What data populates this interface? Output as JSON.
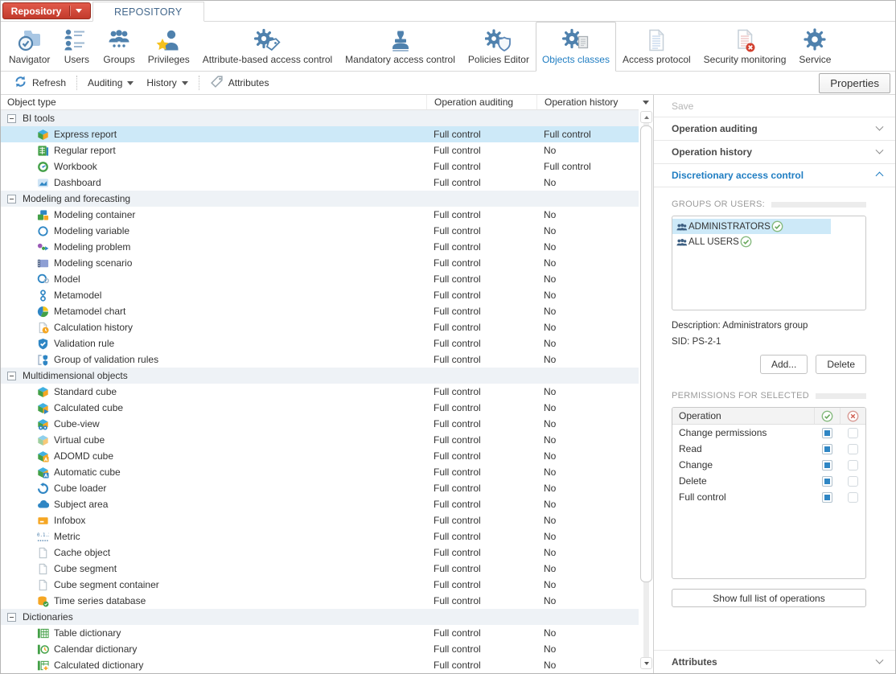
{
  "app": {
    "menu_button": "Repository",
    "tab": "REPOSITORY"
  },
  "ribbon": {
    "items": [
      {
        "label": "Navigator",
        "icon": "navigator"
      },
      {
        "label": "Users",
        "icon": "users"
      },
      {
        "label": "Groups",
        "icon": "groups"
      },
      {
        "label": "Privileges",
        "icon": "privileges"
      },
      {
        "label": "Attribute-based access control",
        "icon": "attribute-access"
      },
      {
        "label": "Mandatory access control",
        "icon": "mandatory-access"
      },
      {
        "label": "Policies Editor",
        "icon": "policies-editor"
      },
      {
        "label": "Objects classes",
        "icon": "objects-classes",
        "selected": true
      },
      {
        "label": "Access protocol",
        "icon": "access-protocol"
      },
      {
        "label": "Security monitoring",
        "icon": "security-monitoring"
      },
      {
        "label": "Service",
        "icon": "service"
      }
    ]
  },
  "toolbar": {
    "refresh": "Refresh",
    "auditing": "Auditing",
    "history": "History",
    "attributes": "Attributes",
    "properties": "Properties"
  },
  "table": {
    "columns": [
      "Object type",
      "Operation auditing",
      "Operation history"
    ],
    "rows": [
      {
        "type": "section",
        "label": "BI tools"
      },
      {
        "type": "item",
        "label": "Express report",
        "icon": "cube",
        "auditing": "Full control",
        "history": "Full control",
        "selected": true
      },
      {
        "type": "item",
        "label": "Regular report",
        "icon": "regular-report",
        "auditing": "Full control",
        "history": "No"
      },
      {
        "type": "item",
        "label": "Workbook",
        "icon": "workbook",
        "auditing": "Full control",
        "history": "Full control"
      },
      {
        "type": "item",
        "label": "Dashboard",
        "icon": "dashboard",
        "auditing": "Full control",
        "history": "No"
      },
      {
        "type": "section",
        "label": "Modeling and forecasting"
      },
      {
        "type": "item",
        "label": "Modeling container",
        "icon": "modeling-container",
        "auditing": "Full control",
        "history": "No"
      },
      {
        "type": "item",
        "label": "Modeling variable",
        "icon": "modeling-variable",
        "auditing": "Full control",
        "history": "No"
      },
      {
        "type": "item",
        "label": "Modeling problem",
        "icon": "modeling-problem",
        "auditing": "Full control",
        "history": "No"
      },
      {
        "type": "item",
        "label": "Modeling scenario",
        "icon": "modeling-scenario",
        "auditing": "Full control",
        "history": "No"
      },
      {
        "type": "item",
        "label": "Model",
        "icon": "model",
        "auditing": "Full control",
        "history": "No"
      },
      {
        "type": "item",
        "label": "Metamodel",
        "icon": "metamodel",
        "auditing": "Full control",
        "history": "No"
      },
      {
        "type": "item",
        "label": "Metamodel chart",
        "icon": "metamodel-chart",
        "auditing": "Full control",
        "history": "No"
      },
      {
        "type": "item",
        "label": "Calculation history",
        "icon": "calculation-history",
        "auditing": "Full control",
        "history": "No"
      },
      {
        "type": "item",
        "label": "Validation rule",
        "icon": "validation-rule",
        "auditing": "Full control",
        "history": "No"
      },
      {
        "type": "item",
        "label": "Group of validation rules",
        "icon": "validation-group",
        "auditing": "Full control",
        "history": "No"
      },
      {
        "type": "section",
        "label": "Multidimensional objects"
      },
      {
        "type": "item",
        "label": "Standard cube",
        "icon": "cube",
        "auditing": "Full control",
        "history": "No"
      },
      {
        "type": "item",
        "label": "Calculated cube",
        "icon": "calculated-cube",
        "auditing": "Full control",
        "history": "No"
      },
      {
        "type": "item",
        "label": "Cube-view",
        "icon": "cube-view",
        "auditing": "Full control",
        "history": "No"
      },
      {
        "type": "item",
        "label": "Virtual cube",
        "icon": "virtual-cube",
        "auditing": "Full control",
        "history": "No"
      },
      {
        "type": "item",
        "label": "ADOMD cube",
        "icon": "adomd-cube",
        "auditing": "Full control",
        "history": "No"
      },
      {
        "type": "item",
        "label": "Automatic cube",
        "icon": "automatic-cube",
        "auditing": "Full control",
        "history": "No"
      },
      {
        "type": "item",
        "label": "Cube loader",
        "icon": "cube-loader",
        "auditing": "Full control",
        "history": "No"
      },
      {
        "type": "item",
        "label": "Subject area",
        "icon": "subject-area",
        "auditing": "Full control",
        "history": "No"
      },
      {
        "type": "item",
        "label": "Infobox",
        "icon": "infobox",
        "auditing": "Full control",
        "history": "No"
      },
      {
        "type": "item",
        "label": "Metric",
        "icon": "metric",
        "auditing": "Full control",
        "history": "No"
      },
      {
        "type": "item",
        "label": "Cache object",
        "icon": "document",
        "auditing": "Full control",
        "history": "No"
      },
      {
        "type": "item",
        "label": "Cube segment",
        "icon": "document",
        "auditing": "Full control",
        "history": "No"
      },
      {
        "type": "item",
        "label": "Cube segment container",
        "icon": "document",
        "auditing": "Full control",
        "history": "No"
      },
      {
        "type": "item",
        "label": "Time series database",
        "icon": "time-series-db",
        "auditing": "Full control",
        "history": "No"
      },
      {
        "type": "section",
        "label": "Dictionaries"
      },
      {
        "type": "item",
        "label": "Table dictionary",
        "icon": "table-dictionary",
        "auditing": "Full control",
        "history": "No"
      },
      {
        "type": "item",
        "label": "Calendar dictionary",
        "icon": "calendar-dictionary",
        "auditing": "Full control",
        "history": "No"
      },
      {
        "type": "item",
        "label": "Calculated dictionary",
        "icon": "calculated-dictionary",
        "auditing": "Full control",
        "history": "No"
      }
    ]
  },
  "panel": {
    "save": "Save",
    "sections": {
      "auditing": "Operation auditing",
      "history": "Operation history",
      "dac": "Discretionary access control"
    },
    "groups_label": "GROUPS OR USERS:",
    "groups": [
      {
        "name": "ADMINISTRATORS",
        "selected": true
      },
      {
        "name": "ALL USERS",
        "selected": false
      }
    ],
    "description_label": "Description:",
    "description": "Administrators group",
    "sid_label": "SID:",
    "sid": "PS-2-1",
    "add_button": "Add...",
    "delete_button": "Delete",
    "permissions_label": "PERMISSIONS FOR SELECTED",
    "permissions": {
      "operation_header": "Operation",
      "rows": [
        {
          "name": "Change permissions",
          "allow": true,
          "deny": false
        },
        {
          "name": "Read",
          "allow": true,
          "deny": false
        },
        {
          "name": "Change",
          "allow": true,
          "deny": false
        },
        {
          "name": "Delete",
          "allow": true,
          "deny": false
        },
        {
          "name": "Full control",
          "allow": true,
          "deny": false
        }
      ]
    },
    "show_full_button": "Show full list of operations",
    "attributes": "Attributes"
  },
  "colors": {
    "accent": "#1f7dc2",
    "selection": "#cde9f8",
    "icon_blue": "#4f81ad",
    "menu_red": "#c23b2c"
  }
}
